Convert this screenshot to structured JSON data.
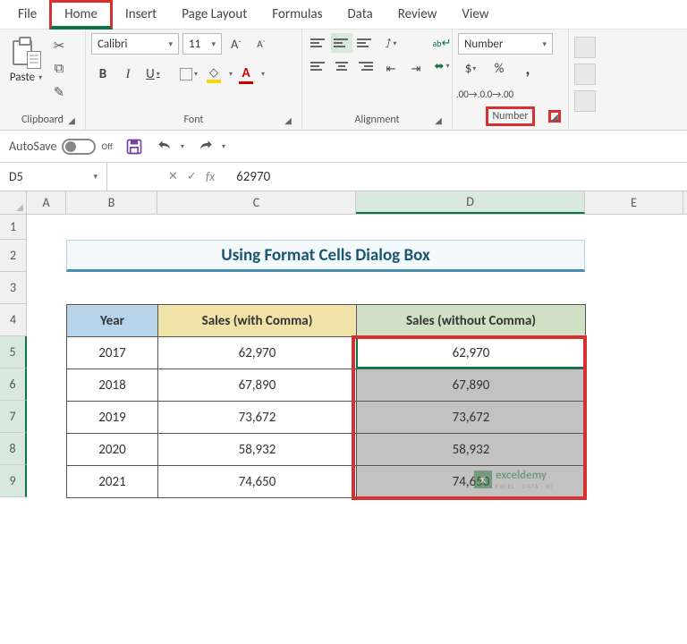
{
  "tabs": [
    "File",
    "Home",
    "Insert",
    "Page Layout",
    "Formulas",
    "Data",
    "Review",
    "View"
  ],
  "active_tab": "Home",
  "clipboard": {
    "paste": "Paste",
    "label": "Clipboard"
  },
  "font": {
    "name": "Calibri",
    "size": "11",
    "label": "Font",
    "bold": "B",
    "italic": "I",
    "underline": "U",
    "grow": "A",
    "shrink": "A"
  },
  "alignment": {
    "label": "Alignment",
    "wrap": "ab"
  },
  "number": {
    "format": "Number",
    "label": "Number",
    "currency": "$",
    "percent": "%",
    "comma": ","
  },
  "qat": {
    "autosave_label": "AutoSave",
    "autosave_state": "Off"
  },
  "namebox": "D5",
  "formula_value": "62970",
  "sheet": {
    "cols": [
      "A",
      "B",
      "C",
      "D",
      "E"
    ],
    "rows": [
      "1",
      "2",
      "3",
      "4",
      "5",
      "6",
      "7",
      "8",
      "9"
    ],
    "title": "Using Format Cells Dialog Box",
    "headers": {
      "year": "Year",
      "with": "Sales (with Comma)",
      "without": "Sales (without Comma)"
    },
    "data": [
      {
        "year": "2017",
        "with": "62,970",
        "without": "62,970"
      },
      {
        "year": "2018",
        "with": "67,890",
        "without": "67,890"
      },
      {
        "year": "2019",
        "with": "73,672",
        "without": "73,672"
      },
      {
        "year": "2020",
        "with": "58,932",
        "without": "58,932"
      },
      {
        "year": "2021",
        "with": "74,650",
        "without": "74,650"
      }
    ]
  },
  "watermark": {
    "brand": "exceldemy",
    "tag": "EXCEL · DATA · BI"
  }
}
